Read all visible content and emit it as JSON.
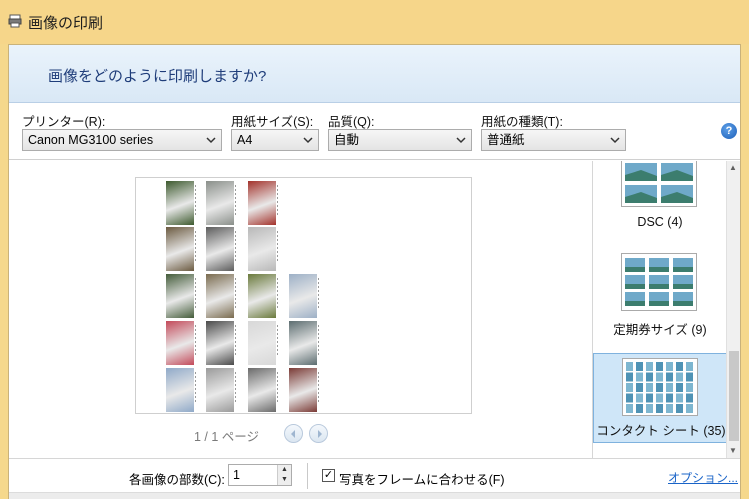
{
  "window": {
    "title": "画像の印刷"
  },
  "header": {
    "question": "画像をどのように印刷しますか?"
  },
  "options": {
    "printer": {
      "label": "プリンター(R):",
      "value": "Canon MG3100 series"
    },
    "paper_size": {
      "label": "用紙サイズ(S):",
      "value": "A4"
    },
    "quality": {
      "label": "品質(Q):",
      "value": "自動"
    },
    "paper_type": {
      "label": "用紙の種類(T):",
      "value": "普通紙"
    },
    "help": "?"
  },
  "preview": {
    "pager": "1 / 1 ページ",
    "thumbnails": [
      "#3d5a2e",
      "#8a8f8a",
      "#a3322b",
      "#6b5a40",
      "#5c5c5c",
      "#b8b8b8",
      "#445c3a",
      "#7a6b4f",
      "#6a7a3c",
      "#9db0c6",
      "#c34a5a",
      "#4a4a4a",
      "#d8d8d8",
      "#5c6d70",
      "#8fa9c8",
      "#9a9a9a",
      "#6a6a6a",
      "#7a3a35"
    ]
  },
  "layouts": {
    "items": [
      {
        "label": "DSC (4)",
        "selected": false
      },
      {
        "label": "定期券サイズ (9)",
        "selected": false
      },
      {
        "label": "コンタクト シート (35)",
        "selected": true
      }
    ]
  },
  "footer": {
    "copies_label": "各画像の部数(C):",
    "copies_value": "1",
    "fit_label": "写真をフレームに合わせる(F)",
    "fit_checked": true,
    "options_link": "オプション..."
  }
}
